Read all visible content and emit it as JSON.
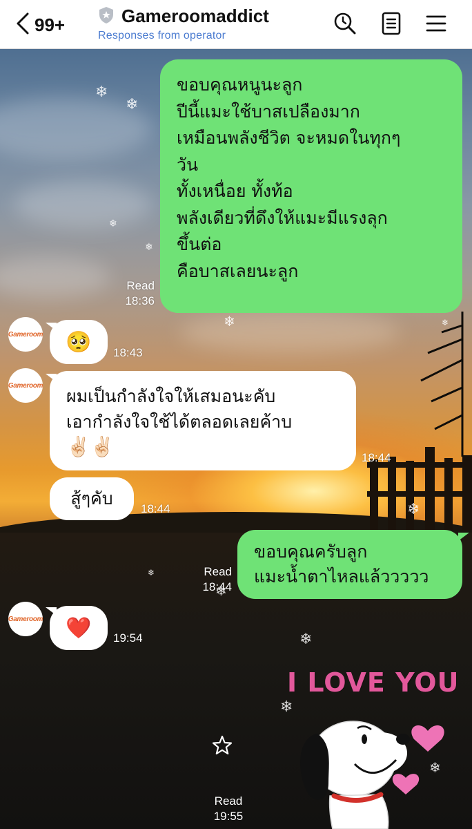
{
  "header": {
    "back_count": "99+",
    "title": "Gameroomaddict",
    "subtitle": "Responses from operator",
    "icons": [
      "back-chevron-icon",
      "shield-icon",
      "search-icon",
      "notes-icon",
      "menu-icon"
    ]
  },
  "contact": {
    "avatar_text": "Gameroom"
  },
  "messages": [
    {
      "side": "me",
      "text": "ขอบคุณหนูนะลูก\nปีนี้แมะใช้บาสเปลืองมาก\nเหมือนพลังชีวิต จะหมดในทุกๆ\nวัน\nทั้งเหนื่อย ทั้งท้อ\nพลังเดียวที่ดึงให้แมะมีแรงลุก\nขึ้นต่อ\nคือบาสเลยนะลูก",
      "read": "Read",
      "time": "18:36"
    },
    {
      "side": "them",
      "emoji": "🥺",
      "time": "18:43"
    },
    {
      "side": "them",
      "text": "ผมเป็นกำลังใจให้เสมอนะคับ\nเอากำลังใจใช้ได้ตลอดเลยค้าบ",
      "emoji": "✌🏻✌🏻",
      "time": "18:44"
    },
    {
      "side": "them",
      "text": "สู้ๆคับ",
      "time": "18:44"
    },
    {
      "side": "me",
      "text": "ขอบคุณครับลูก\nแมะน้ำตาไหลแล้ววววว",
      "read": "Read",
      "time": "18:44"
    },
    {
      "side": "them",
      "emoji": "❤️",
      "time": "19:54"
    },
    {
      "side": "me",
      "sticker_text": "I LOVE YOU",
      "read": "Read",
      "time": "19:55"
    }
  ],
  "colors": {
    "my_bubble": "#6fe276",
    "their_bubble": "#ffffff",
    "subtitle": "#4a7bd0",
    "avatar_text": "#e0662a",
    "sticker_text": "#e2589b"
  }
}
